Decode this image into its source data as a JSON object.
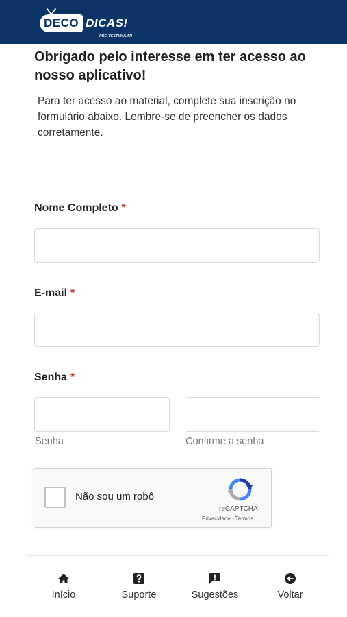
{
  "header": {
    "logo_part1": "DECO",
    "logo_part2": "DICAS!",
    "logo_sub": "PRÉ-VESTIBULAR",
    "background_color": "#0c3466"
  },
  "intro": {
    "title": "Obrigado pelo interesse em ter acesso ao nosso aplicativo!",
    "text": "Para ter acesso ao material, complete sua inscrição no formulário abaixo. Lembre-se de preencher os dados corretamente."
  },
  "form": {
    "required_marker": "*",
    "name": {
      "label": "Nome Completo",
      "value": ""
    },
    "email": {
      "label": "E-mail",
      "value": ""
    },
    "password": {
      "label": "Senha",
      "value": "",
      "confirm_value": "",
      "hint": "Senha",
      "confirm_hint": "Confirme a senha"
    }
  },
  "captcha": {
    "label": "Não sou um robô",
    "brand": "reCAPTCHA",
    "links": "Privacidade - Termos"
  },
  "nav": {
    "items": [
      {
        "label": "Início",
        "icon": "home-icon"
      },
      {
        "label": "Suporte",
        "icon": "help-icon"
      },
      {
        "label": "Sugestões",
        "icon": "feedback-icon"
      },
      {
        "label": "Voltar",
        "icon": "back-icon"
      }
    ]
  }
}
